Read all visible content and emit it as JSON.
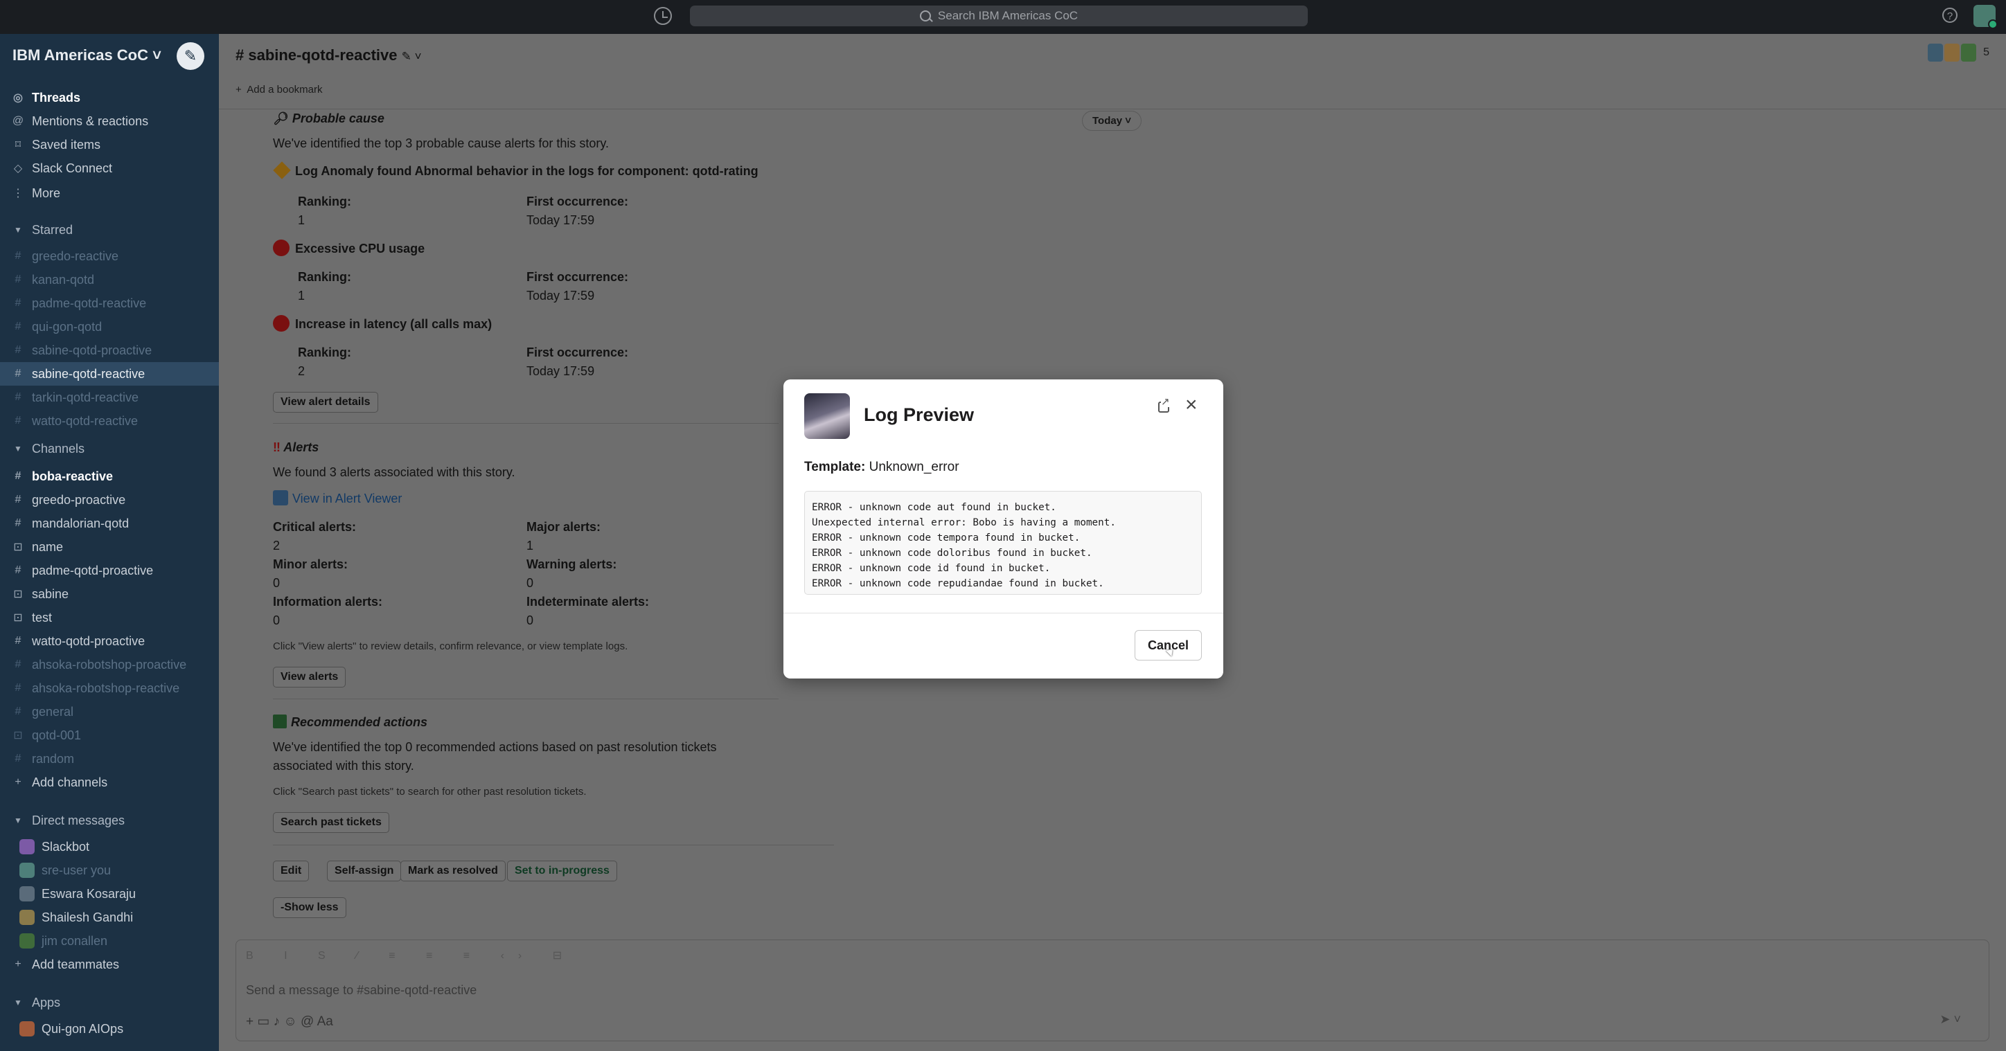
{
  "topbar": {
    "search_placeholder": "Search IBM Americas CoC",
    "help_label": "?"
  },
  "sidebar": {
    "workspace": "IBM Americas CoC ˅",
    "nav": [
      {
        "label": "Threads",
        "icon": "threads-icon"
      },
      {
        "label": "Mentions & reactions",
        "icon": "at-icon"
      },
      {
        "label": "Saved items",
        "icon": "bookmark-icon"
      },
      {
        "label": "Slack Connect",
        "icon": "connect-icon"
      },
      {
        "label": "More",
        "icon": "more-icon"
      }
    ],
    "starred_label": "Starred",
    "starred": [
      "greedo-reactive",
      "kanan-qotd",
      "padme-qotd-reactive",
      "qui-gon-qotd",
      "sabine-qotd-proactive",
      "sabine-qotd-reactive",
      "tarkin-qotd-reactive",
      "watto-qotd-reactive"
    ],
    "channels_label": "Channels",
    "channels": [
      "boba-reactive",
      "greedo-proactive",
      "mandalorian-qotd",
      "name",
      "padme-qotd-proactive",
      "sabine",
      "test",
      "watto-qotd-proactive",
      "ahsoka-robotshop-proactive",
      "ahsoka-robotshop-reactive",
      "general",
      "qotd-001",
      "random"
    ],
    "add_channels": "Add channels",
    "dms_label": "Direct messages",
    "dms": [
      "Slackbot",
      "sre-user  you",
      "Eswara Kosaraju",
      "Shailesh Gandhi",
      "jim conallen"
    ],
    "add_teammates": "Add teammates",
    "apps_label": "Apps",
    "apps": [
      "Qui-gon AIOps"
    ]
  },
  "channel": {
    "title": "# sabine-qotd-reactive",
    "add_bookmark": "Add a bookmark",
    "member_count": "5",
    "today": "Today"
  },
  "story": {
    "probable_title": "Probable cause",
    "probable_desc": "We've identified the top 3 probable cause alerts for this story.",
    "ranking_label": "Ranking:",
    "first_label": "First occurrence:",
    "alerts": [
      {
        "title": "Log Anomaly found Abnormal behavior in the logs for component: qotd-rating",
        "ranking": "1",
        "first": "Today 17:59"
      },
      {
        "title": "Excessive CPU usage",
        "ranking": "1",
        "first": "Today 17:59"
      },
      {
        "title": "Increase in latency (all calls max)",
        "ranking": "2",
        "first": "Today 17:59"
      }
    ],
    "view_alert_details": "View alert details",
    "alerts_title": "Alerts",
    "alerts_desc": "We found 3 alerts associated with this story.",
    "view_in_viewer": "View in Alert Viewer",
    "counts": {
      "critical_label": "Critical alerts:",
      "critical": "2",
      "major_label": "Major alerts:",
      "major": "1",
      "minor_label": "Minor alerts:",
      "minor": "0",
      "warning_label": "Warning alerts:",
      "warning": "0",
      "info_label": "Information alerts:",
      "info": "0",
      "indeterminate_label": "Indeterminate alerts:",
      "indeterminate": "0"
    },
    "alerts_hint": "Click \"View alerts\" to review details, confirm relevance, or view template logs.",
    "view_alerts": "View alerts",
    "rec_title": "Recommended actions",
    "rec_desc_1": "We've identified the top 0 recommended actions based on past resolution tickets",
    "rec_desc_2": "associated with this story.",
    "rec_hint": "Click \"Search past tickets\" to search for other past resolution tickets.",
    "search_tickets": "Search past tickets",
    "actions": [
      "Edit",
      "Self-assign",
      "Mark as resolved",
      "Set to in-progress"
    ],
    "show_less": "-Show less"
  },
  "composer": {
    "placeholder": "Send a message to #sabine-qotd-reactive",
    "format_bar": "B I S ⁄ ≡ ≡ ≡ ‹› ⊟",
    "tools": "+   ▭  ♪   ☺  @  Aa",
    "send": "➤ ˅"
  },
  "modal": {
    "title": "Log Preview",
    "template_label": "Template:",
    "template_value": "Unknown_error",
    "log_lines": [
      "ERROR - unknown code aut found in bucket.",
      "Unexpected internal error: Bobo is having a moment.",
      "ERROR - unknown code tempora found in bucket.",
      "ERROR - unknown code doloribus found in bucket.",
      "ERROR - unknown code id found in bucket.",
      "ERROR - unknown code repudiandae found in bucket."
    ],
    "cancel": "Cancel",
    "close": "×"
  }
}
